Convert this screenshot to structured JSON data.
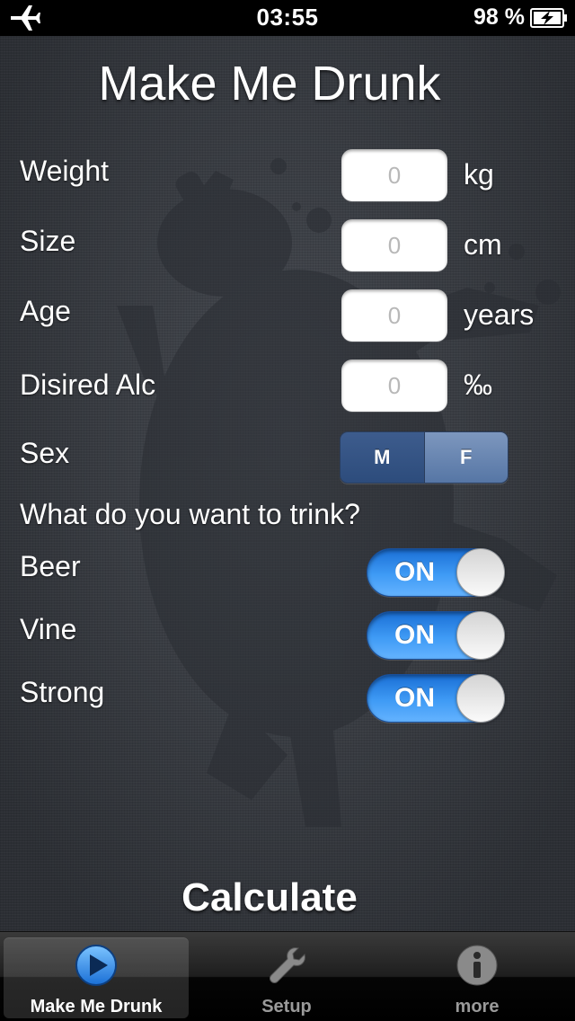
{
  "status_bar": {
    "time": "03:55",
    "battery": "98 %",
    "icons": [
      "airplane-icon",
      "battery-charging-icon"
    ]
  },
  "app_title": "Make Me Drunk",
  "fields": [
    {
      "label": "Weight",
      "placeholder": "0",
      "value": "",
      "unit": "kg"
    },
    {
      "label": "Size",
      "placeholder": "0",
      "value": "",
      "unit": "cm"
    },
    {
      "label": "Age",
      "placeholder": "0",
      "value": "",
      "unit": "years"
    },
    {
      "label": "Disired Alc",
      "placeholder": "0",
      "value": "",
      "unit": "‰"
    }
  ],
  "sex": {
    "label": "Sex",
    "options": [
      "M",
      "F"
    ],
    "selected": "M"
  },
  "drinks_heading": "What do you want to trink?",
  "drinks": [
    {
      "label": "Beer",
      "state": "ON"
    },
    {
      "label": "Vine",
      "state": "ON"
    },
    {
      "label": "Strong",
      "state": "ON"
    }
  ],
  "calculate_label": "Calculate",
  "tabs": [
    {
      "label": "Make Me Drunk",
      "icon": "play-icon",
      "active": true
    },
    {
      "label": "Setup",
      "icon": "wrench-icon",
      "active": false
    },
    {
      "label": "more",
      "icon": "info-icon",
      "active": false
    }
  ],
  "colors": {
    "switch_on": "#3f9bf5",
    "segment_selected": "#2d4c7c",
    "background": "#3b3f46"
  }
}
